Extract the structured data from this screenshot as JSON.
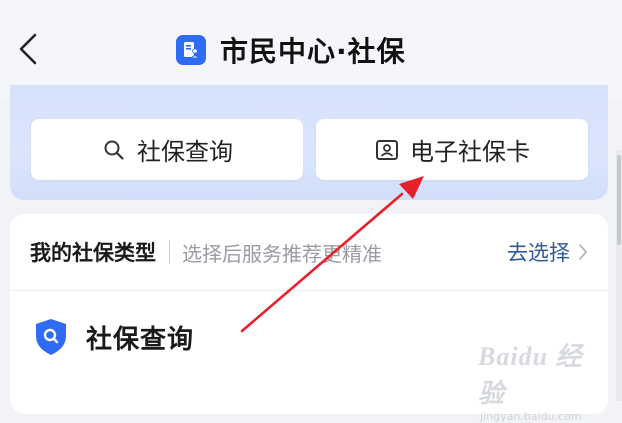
{
  "header": {
    "back_icon": "chevron-left-icon",
    "app_icon": "document-person-icon",
    "title": "市民中心·社保"
  },
  "banner": {
    "background_color": "#d6e2fb",
    "buttons": [
      {
        "label": "社保查询",
        "icon": "search-icon"
      },
      {
        "label": "电子社保卡",
        "icon": "id-card-icon"
      }
    ]
  },
  "type_row": {
    "label": "我的社保类型",
    "hint": "选择后服务推荐更精准",
    "action": "去选择",
    "action_color": "#2e5a97"
  },
  "section": {
    "title": "社保查询",
    "icon": "shield-search-icon",
    "icon_color": "#2f6bf5"
  },
  "annotation": {
    "color": "#e8202a",
    "shape": "arrow"
  },
  "watermark": {
    "main": "Baidu 经验",
    "sub": "jingyan.baidu.com"
  }
}
